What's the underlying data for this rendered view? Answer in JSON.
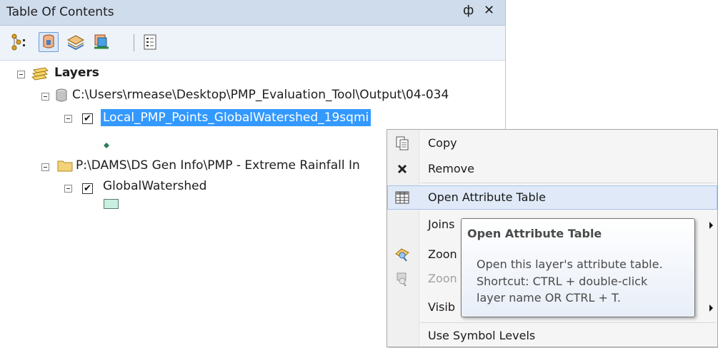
{
  "toc": {
    "title": "Table Of Contents",
    "pin_glyph": "ф",
    "close_glyph": "✕",
    "toolbar": [
      {
        "icon": "list-by-drawing-order-icon",
        "active": false
      },
      {
        "icon": "list-by-source-icon",
        "active": true
      },
      {
        "icon": "list-by-visibility-icon",
        "active": false
      },
      {
        "icon": "list-by-selection-icon",
        "active": false
      },
      {
        "icon": "options-icon",
        "active": false
      }
    ],
    "tree": {
      "root_label": "Layers",
      "source1_path": "C:\\Users\\rmease\\Desktop\\PMP_Evaluation_Tool\\Output\\04-034",
      "layer1_label": "Local_PMP_Points_GlobalWatershed_19sqmi",
      "layer1_checked": true,
      "source2_path": "P:\\DAMS\\DS Gen Info\\PMP - Extreme Rainfall In",
      "layer2_label": "GlobalWatershed",
      "layer2_checked": true,
      "checkmark": "✔"
    }
  },
  "context_menu": {
    "items": [
      {
        "label": "Copy",
        "icon": "copy-icon"
      },
      {
        "label": "Remove",
        "icon": "remove-icon"
      },
      {
        "label": "Open Attribute Table",
        "icon": "attribute-table-icon",
        "highlighted": true
      },
      {
        "label": "Joins",
        "icon": "",
        "submenu": true
      },
      {
        "label": "Zoon",
        "icon": "zoom-to-layer-icon"
      },
      {
        "label": "Zoon",
        "icon": "zoom-to-visible-scale-icon",
        "disabled": true
      },
      {
        "label": "Visib",
        "icon": "",
        "submenu": true
      },
      {
        "label": "Use Symbol Levels",
        "icon": ""
      }
    ]
  },
  "tooltip": {
    "title": "Open Attribute Table",
    "line1": "Open this layer's attribute table.",
    "line2": "Shortcut: CTRL + double-click",
    "line3": "layer name OR CTRL + T."
  },
  "colors": {
    "selection": "#3399ff",
    "titlebar": "#cfdcec",
    "menu_hover": "#dfe9f7",
    "polygon_fill": "#c8f0e0"
  }
}
